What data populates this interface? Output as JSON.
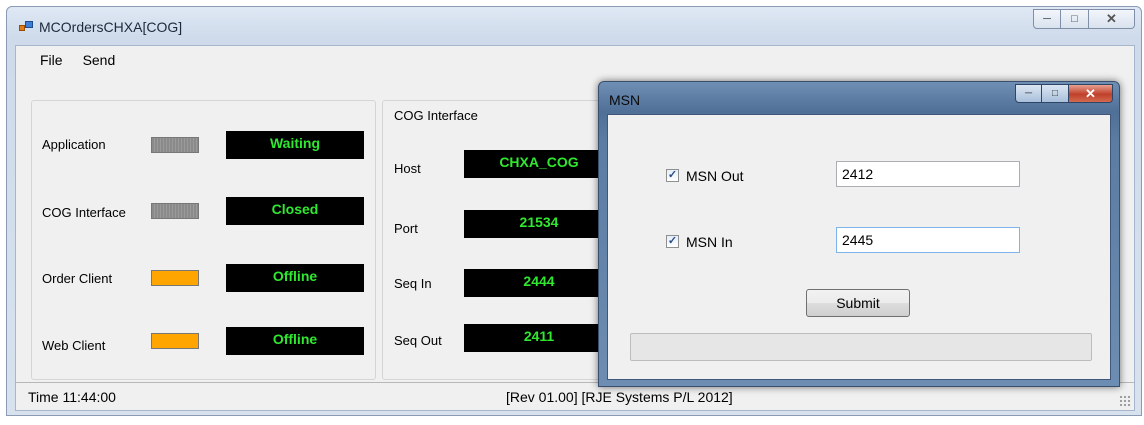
{
  "window": {
    "title": "MCOrdersCHXA[COG]"
  },
  "menu": {
    "items": [
      "File",
      "Send"
    ]
  },
  "status_panel": {
    "rows": [
      {
        "label": "Application",
        "indicator": "gray",
        "status": "Waiting"
      },
      {
        "label": "COG Interface",
        "indicator": "gray",
        "status": "Closed"
      },
      {
        "label": "Order Client",
        "indicator": "orange",
        "status": "Offline"
      },
      {
        "label": "Web Client",
        "indicator": "orange",
        "status": "Offline"
      }
    ]
  },
  "cog_interface": {
    "caption": "COG Interface",
    "fields": [
      {
        "label": "Host",
        "value": "CHXA_COG"
      },
      {
        "label": "Port",
        "value": "21534"
      },
      {
        "label": "Seq In",
        "value": "2444"
      },
      {
        "label": "Seq Out",
        "value": "2411"
      }
    ]
  },
  "statusbar": {
    "time": "Time  11:44:00",
    "revision": "[Rev 01.00] [RJE Systems P/L 2012]"
  },
  "msn_dialog": {
    "title": "MSN",
    "msn_out": {
      "label": "MSN Out",
      "checked": true,
      "value": "2412"
    },
    "msn_in": {
      "label": "MSN In",
      "checked": true,
      "value": "2445"
    },
    "submit_label": "Submit",
    "progress": 0
  },
  "colors": {
    "lcd_text": "#2fe82f",
    "indicator_orange": "#ffa500",
    "indicator_gray": "#8a8a8a"
  },
  "icons": [
    "app-icon",
    "minimize-icon",
    "maximize-icon",
    "close-icon",
    "checkmark-icon",
    "resize-grip-icon"
  ]
}
